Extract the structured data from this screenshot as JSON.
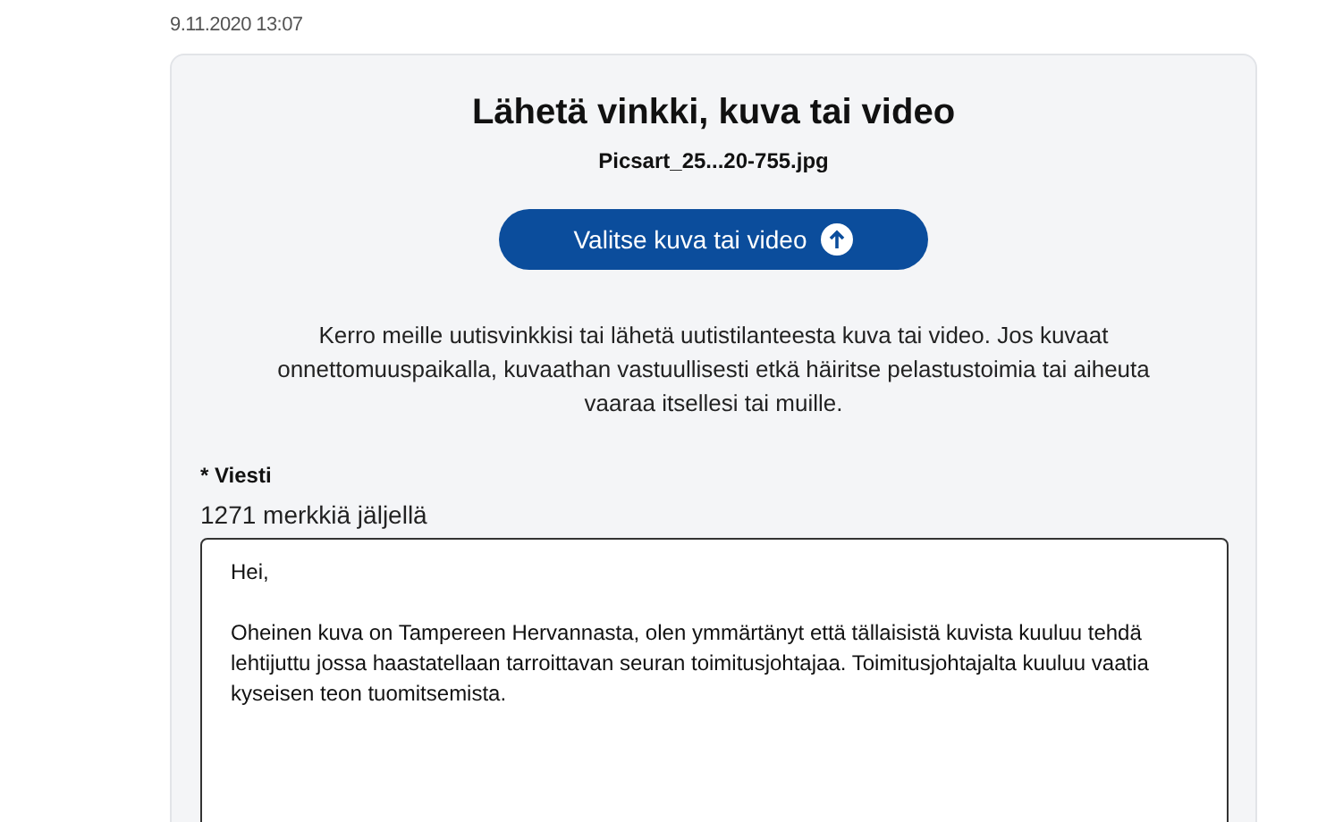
{
  "timestamp": "9.11.2020 13:07",
  "form": {
    "title": "Lähetä vinkki, kuva tai video",
    "file_name": "Picsart_25...20-755.jpg",
    "upload_button": "Valitse kuva tai video",
    "description": "Kerro meille uutisvinkkisi tai lähetä uutistilanteesta kuva tai video. Jos kuvaat onnettomuuspaikalla, kuvaathan vastuullisesti etkä häiritse pelastustoimia tai aiheuta vaaraa itsellesi tai muille.",
    "message_label": "* Viesti",
    "chars_left": "1271 merkkiä jäljellä",
    "message_value": "Hei,\n\nOheinen kuva on Tampereen Hervannasta, olen ymmärtänyt että tällaisistä kuvista kuuluu tehdä lehtijuttu jossa haastatellaan tarroittavan seuran toimitusjohtajaa. Toimitusjohtajalta kuuluu vaatia kyseisen teon tuomitsemista."
  }
}
